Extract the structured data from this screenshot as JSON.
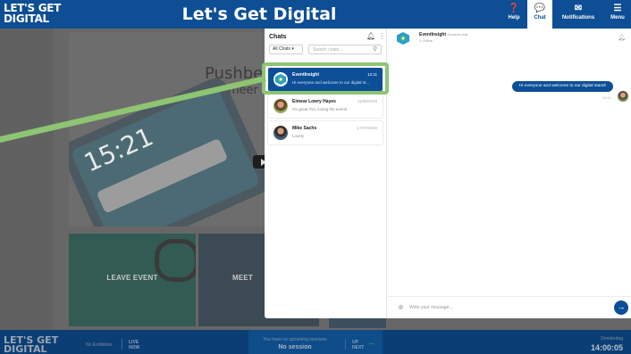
{
  "header": {
    "logo_line1": "LET'S GET",
    "logo_line2": "DIGITAL",
    "title": "Let's Get Digital",
    "nav": [
      {
        "label": "Help",
        "icon": "help-icon",
        "glyph": "❓"
      },
      {
        "label": "Chat",
        "icon": "chat-icon",
        "glyph": "💬",
        "active": true
      },
      {
        "label": "Notifications",
        "icon": "envelope-icon",
        "glyph": "✉"
      },
      {
        "label": "Menu",
        "icon": "menu-icon",
        "glyph": "☰"
      }
    ]
  },
  "background": {
    "hero_title": "Pushber",
    "hero_subtitle": "nformeer",
    "hero_time": "15:21",
    "tiles": {
      "leave_event": "LEAVE EVENT",
      "meet": "MEET"
    }
  },
  "chats": {
    "title": "Chats",
    "filter": "All Chats",
    "search_placeholder": "Search chats...",
    "items": [
      {
        "name": "EventInsight",
        "preview": "Hi everyone and welcome to our digital st...",
        "time": "12:11",
        "active": true
      },
      {
        "name": "Eimear Lowry Hayes",
        "preview": "I'm great Tim, loving the event!",
        "time": "11/08/2020"
      },
      {
        "name": "Mike Sachs",
        "preview": "Lovely",
        "time": "17/07/2020"
      }
    ]
  },
  "conversation": {
    "name": "EventInsight",
    "type": "General chat",
    "status": "1 Online",
    "message": "Hi everyone and welcome to our digital stand!",
    "message_time": "12:11",
    "input_placeholder": "Write your message..."
  },
  "footer": {
    "logo_line1": "LET'S GET",
    "logo_line2": "DIGITAL",
    "event_status": "No Exhibition",
    "live_line1": "LIVE",
    "live_line2": "NOW",
    "session_sub": "You have no upcoming sessions",
    "session_main": "No session",
    "up_line1": "UP",
    "up_line2": "NEXT",
    "clock_date": "Donderdag",
    "clock_time": "14:00:05"
  },
  "colors": {
    "brand": "#0d4e94",
    "highlight": "#8dc572"
  }
}
